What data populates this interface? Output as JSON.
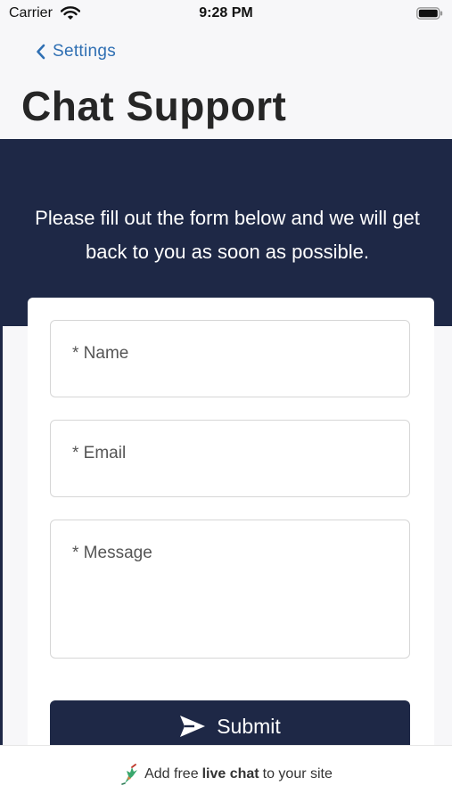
{
  "status_bar": {
    "carrier": "Carrier",
    "time": "9:28 PM",
    "icons": [
      "wifi-icon",
      "battery-icon"
    ]
  },
  "nav": {
    "back_label": "Settings",
    "back_icon": "chevron-left-icon",
    "title": "Chat Support"
  },
  "hero": {
    "intro_text": "Please fill out the form below and we will get back to you as soon as possible."
  },
  "form": {
    "name_placeholder": "* Name",
    "email_placeholder": "* Email",
    "message_placeholder": "* Message",
    "submit_label": "Submit",
    "submit_icon": "send-icon"
  },
  "footer": {
    "prefix": "Add free",
    "emphasis": "live chat",
    "suffix": "to your site",
    "icon": "hummingbird-logo-icon"
  },
  "colors": {
    "brand_navy": "#1e2846",
    "link_blue": "#2f6fb3",
    "background": "#f7f7f9"
  }
}
